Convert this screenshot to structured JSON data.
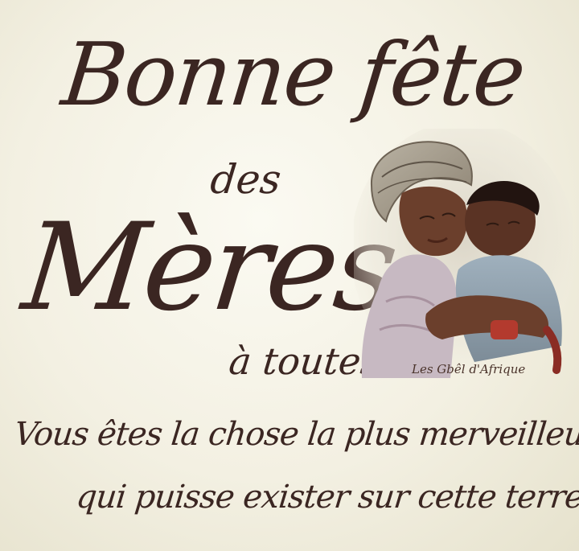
{
  "title": {
    "line1": "Bonne fête",
    "line2": "des",
    "line3": "Mères",
    "line4": "à toutes"
  },
  "message": {
    "line1": "Vous êtes la chose la plus merveilleuse",
    "line2": "qui puisse exister sur cette terre ."
  },
  "image": {
    "signature": "Les Gbêl d'Afrique"
  },
  "colors": {
    "text": "#3b2622",
    "background": "#f5f2e6"
  }
}
